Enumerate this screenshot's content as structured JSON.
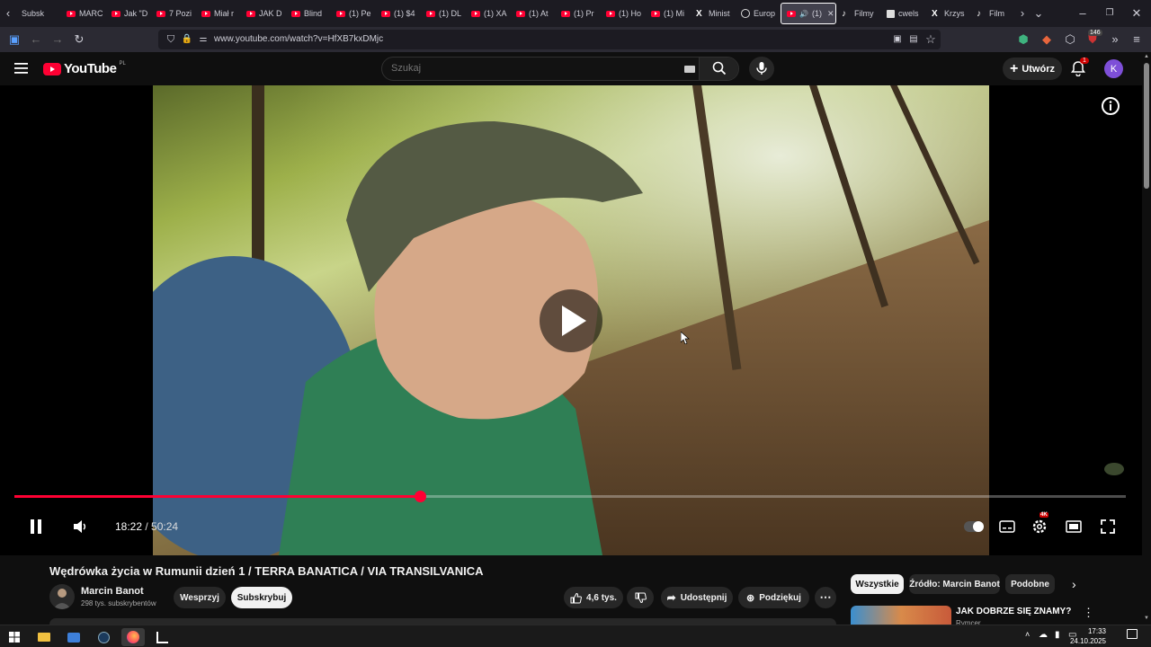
{
  "browser": {
    "tabs": [
      {
        "label": "Subsk",
        "icon": "none"
      },
      {
        "label": "MARC",
        "icon": "youtube"
      },
      {
        "label": "Jak \"D",
        "icon": "youtube"
      },
      {
        "label": "7 Pozi",
        "icon": "youtube"
      },
      {
        "label": "Miał r",
        "icon": "youtube"
      },
      {
        "label": "JAK D",
        "icon": "youtube"
      },
      {
        "label": "Blind",
        "icon": "youtube"
      },
      {
        "label": "(1) Pe",
        "icon": "youtube"
      },
      {
        "label": "(1) $4",
        "icon": "youtube"
      },
      {
        "label": "(1) DL",
        "icon": "youtube"
      },
      {
        "label": "(1) XA",
        "icon": "youtube"
      },
      {
        "label": "(1) At",
        "icon": "youtube"
      },
      {
        "label": "(1) Pr",
        "icon": "youtube"
      },
      {
        "label": "(1) Ho",
        "icon": "youtube"
      },
      {
        "label": "(1) Mi",
        "icon": "youtube"
      },
      {
        "label": "Minist",
        "icon": "x"
      },
      {
        "label": "Europ",
        "icon": "globe"
      },
      {
        "label": "(1)",
        "icon": "youtube",
        "active": true
      },
      {
        "label": "Filmy",
        "icon": "tiktok"
      },
      {
        "label": "cwels",
        "icon": "doc"
      },
      {
        "label": "Krzys",
        "icon": "x"
      },
      {
        "label": "Film",
        "icon": "tiktok"
      }
    ],
    "url": "www.youtube.com/watch?v=HfXB7kxDMjc",
    "extension_badge": "146"
  },
  "youtube": {
    "logo_text": "YouTube",
    "region": "PL",
    "search_placeholder": "Szukaj",
    "create_label": "Utwórz",
    "notifications_count": "1",
    "avatar_letter": "K",
    "accent": "#ff0033"
  },
  "player": {
    "current_time": "18:22",
    "separator": " / ",
    "duration": "50:24",
    "progress_fraction": 0.365,
    "quality_badge": "4K",
    "state": "paused-overlay"
  },
  "video": {
    "title": "Wędrówka życia w Rumunii dzień 1 / TERRA BANATICA / VIA TRANSILVANICA",
    "channel_name": "Marcin Banot",
    "subscribers": "298 tys. subskrybentów",
    "support_label": "Wesprzyj",
    "subscribe_label": "Subskrybuj",
    "likes": "4,6 tys.",
    "share_label": "Udostępnij",
    "thanks_label": "Podziękuj"
  },
  "sidebar": {
    "chips": [
      "Wszystkie",
      "Źródło: Marcin Banot",
      "Podobne"
    ],
    "next_video_title": "JAK DOBRZE SIĘ ZNAMY?",
    "next_video_channel": "Rymcer"
  },
  "taskbar": {
    "time": "17:33",
    "date": "24.10.2025"
  }
}
